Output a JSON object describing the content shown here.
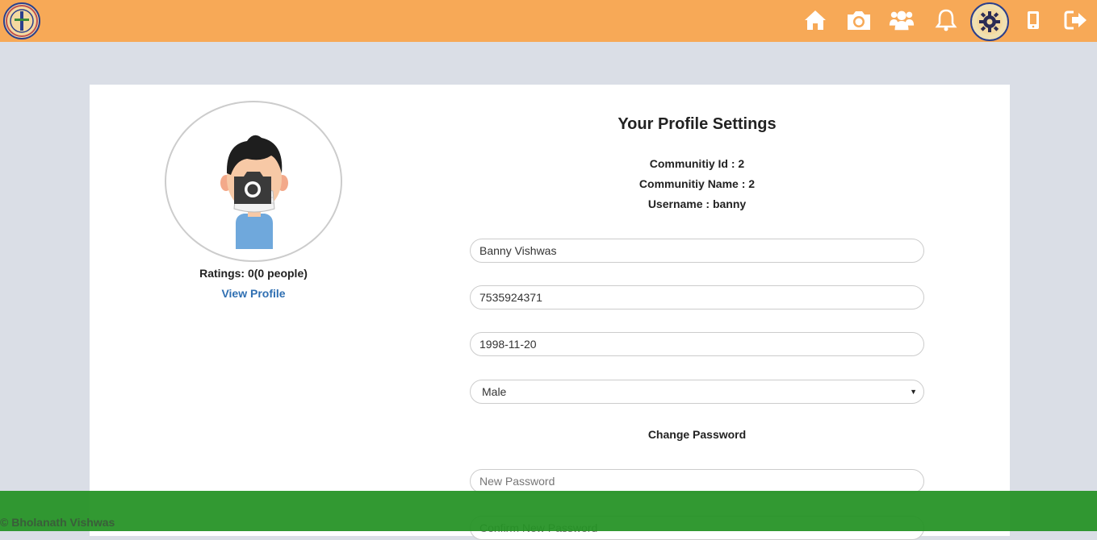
{
  "nav": {
    "icons": [
      "home-icon",
      "camera-icon",
      "users-icon",
      "bell-icon",
      "settings-icon",
      "mobile-icon",
      "logout-icon"
    ]
  },
  "colors": {
    "topbar": "#f7a957",
    "background": "#dadee6",
    "footer": "#2a972a",
    "link": "#2f6fb2"
  },
  "profile": {
    "ratings": "Ratings: 0(0 people)",
    "view_profile": "View Profile"
  },
  "settings": {
    "title": "Your Profile Settings",
    "community_id": "Communitiy Id : 2",
    "community_name": "Communitiy Name : 2",
    "username": "Username : banny",
    "full_name": "Banny Vishwas",
    "phone": "7535924371",
    "dob": "1998-11-20",
    "gender": "Male",
    "change_password": "Change Password",
    "new_password_placeholder": "New Password",
    "confirm_password_placeholder": "Confirm New Password"
  },
  "footer": {
    "copyright": "© Bholanath Vishwas"
  }
}
